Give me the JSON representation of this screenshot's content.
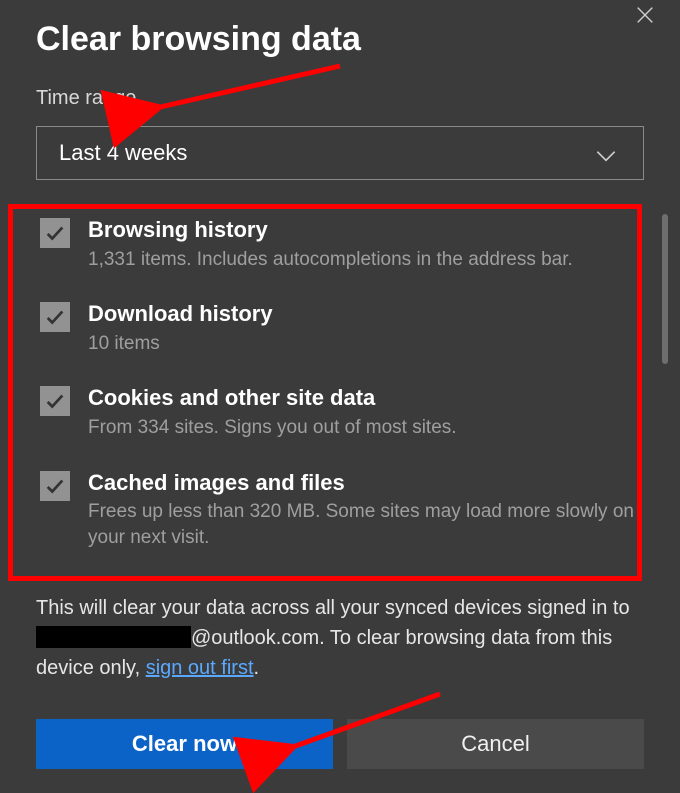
{
  "dialog": {
    "title": "Clear browsing data"
  },
  "time_range": {
    "label": "Time range",
    "selected": "Last 4 weeks"
  },
  "options": [
    {
      "checked": true,
      "title": "Browsing history",
      "desc": "1,331 items. Includes autocompletions in the address bar."
    },
    {
      "checked": true,
      "title": "Download history",
      "desc": "10 items"
    },
    {
      "checked": true,
      "title": "Cookies and other site data",
      "desc": "From 334 sites. Signs you out of most sites."
    },
    {
      "checked": true,
      "title": "Cached images and files",
      "desc": "Frees up less than 320 MB. Some sites may load more slowly on your next visit."
    }
  ],
  "sync_note": {
    "prefix": "This will clear your data across all your synced devices signed in to ",
    "email_domain": "@outlook.com",
    "middle": ". To clear browsing data from this device only, ",
    "link": "sign out first",
    "suffix": "."
  },
  "buttons": {
    "primary": "Clear now",
    "secondary": "Cancel"
  }
}
